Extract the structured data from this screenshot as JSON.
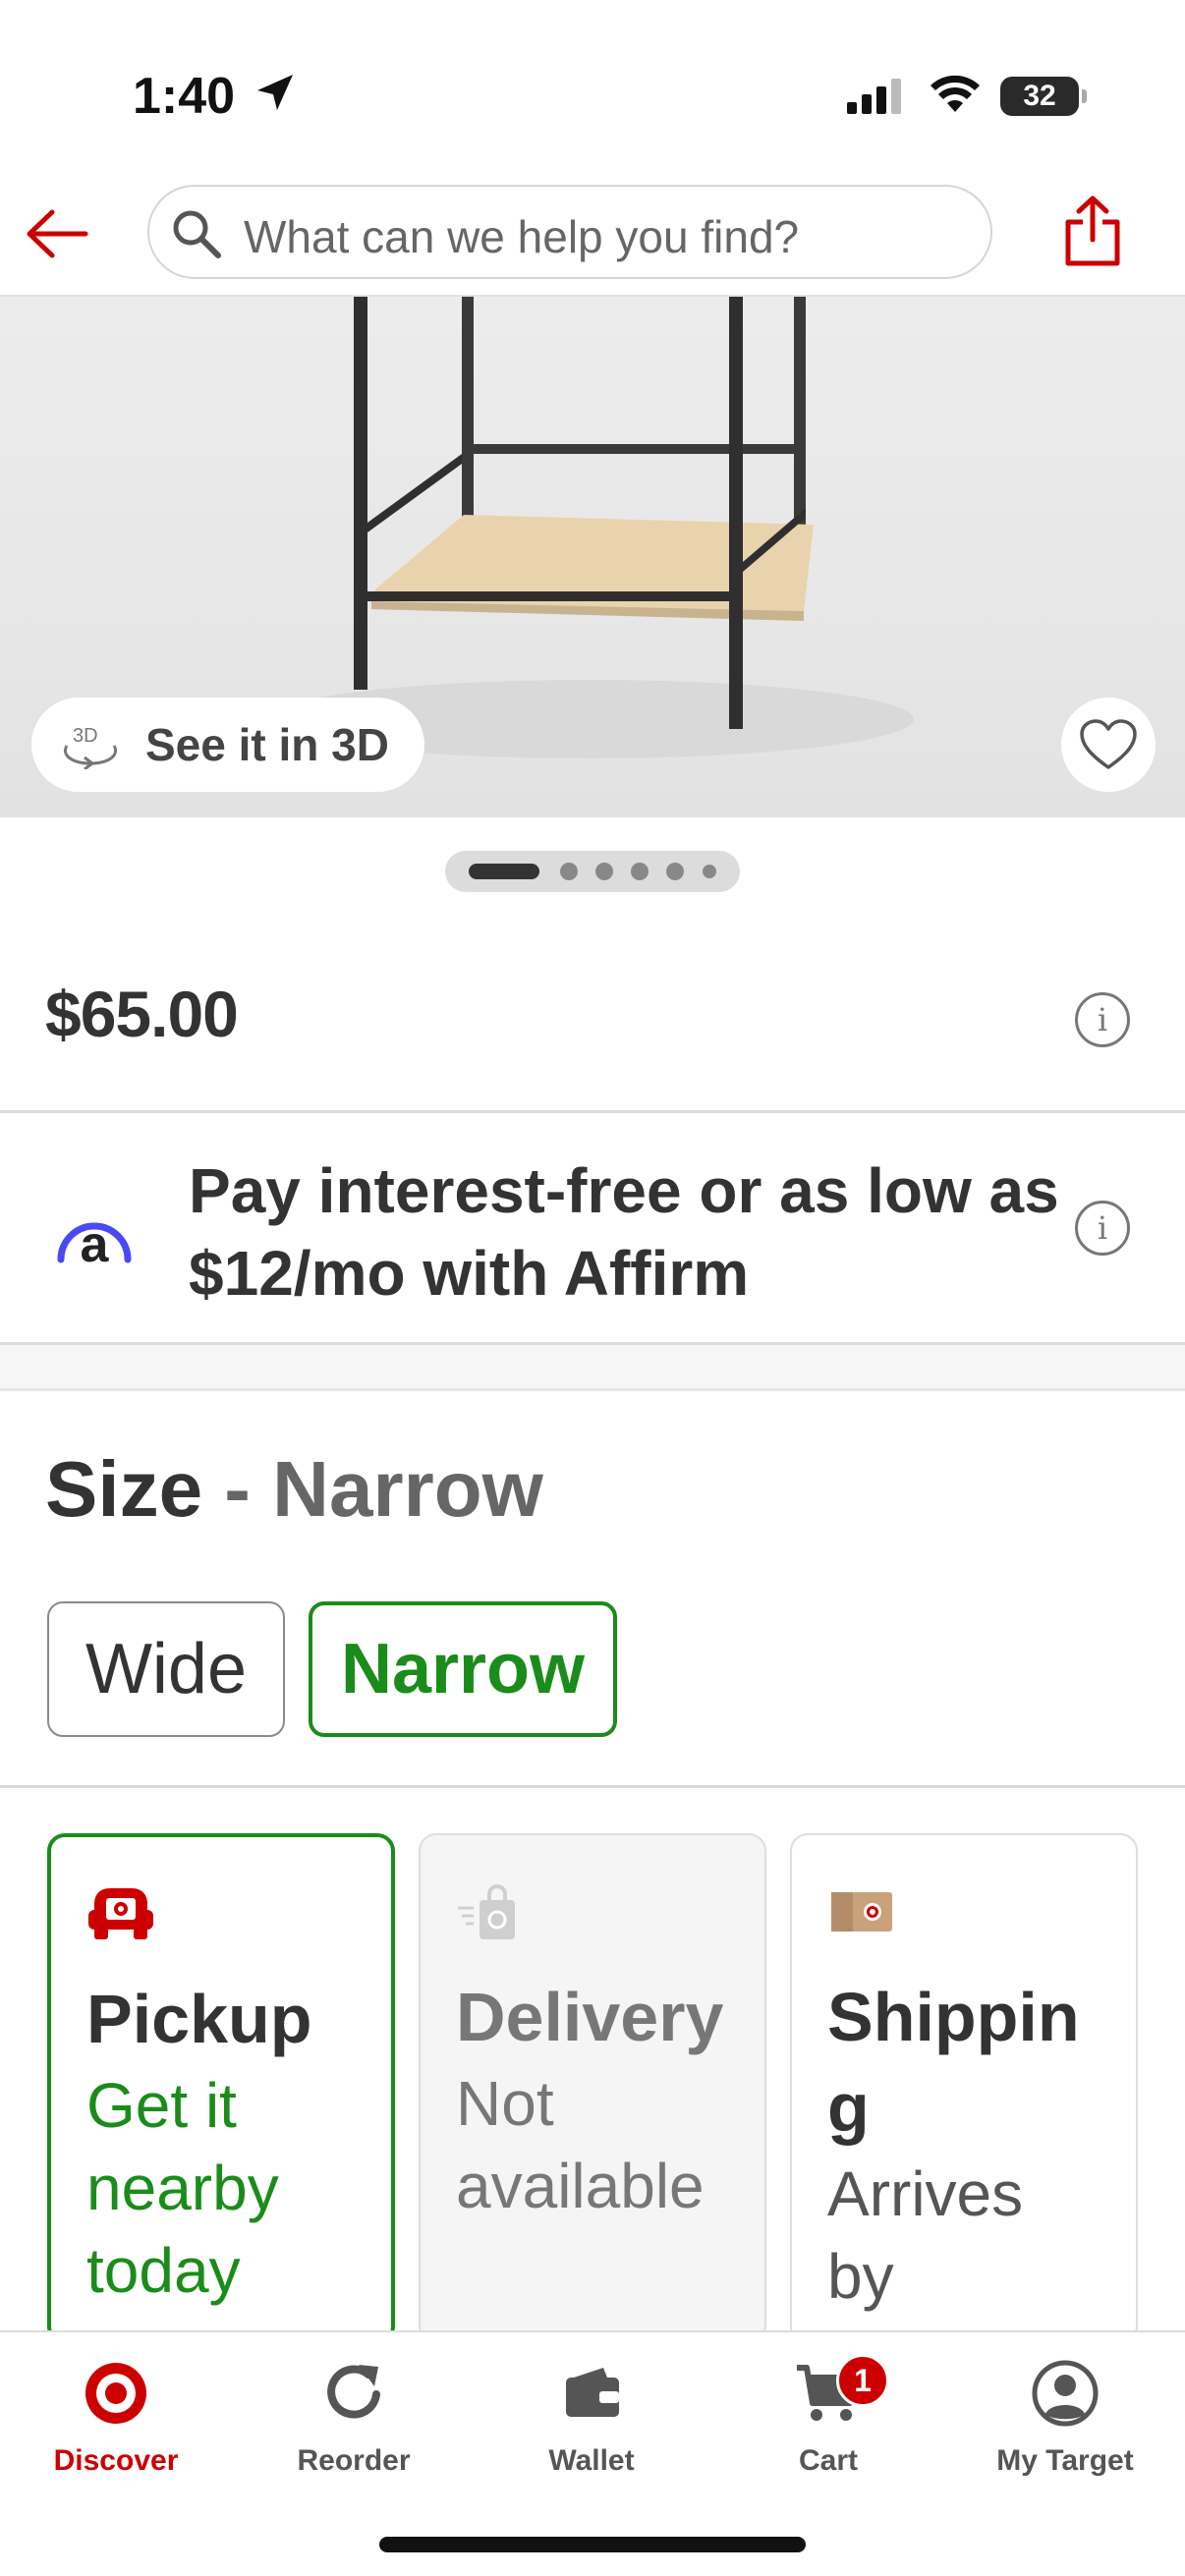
{
  "status_bar": {
    "time": "1:40",
    "battery": "32"
  },
  "header": {
    "search_placeholder": "What can we help you find?"
  },
  "hero": {
    "see_3d_label": "See it in 3D",
    "badge_3d": "3D"
  },
  "carousel": {
    "total": 6,
    "active": 1
  },
  "price": {
    "amount": "$65.00"
  },
  "affirm": {
    "logo_letter": "a",
    "text": "Pay interest-free or as low as $12/mo with Affirm"
  },
  "size": {
    "label": "Size",
    "separator": " - ",
    "selected": "Narrow",
    "options": [
      {
        "label": "Wide",
        "selected": false
      },
      {
        "label": "Narrow",
        "selected": true
      }
    ]
  },
  "fulfillment": [
    {
      "title": "Pickup",
      "subtitle": "Get it nearby today",
      "state": "selected",
      "icon": "pickup-car-icon"
    },
    {
      "title": "Delivery",
      "subtitle": "Not available",
      "state": "disabled",
      "icon": "delivery-bag-icon"
    },
    {
      "title": "Shipping",
      "subtitle": "Arrives by",
      "state": "default",
      "icon": "shipping-box-icon"
    }
  ],
  "bottom_nav": {
    "items": [
      {
        "label": "Discover",
        "icon": "target-bullseye-icon",
        "active": true
      },
      {
        "label": "Reorder",
        "icon": "reorder-icon",
        "active": false
      },
      {
        "label": "Wallet",
        "icon": "wallet-icon",
        "active": false
      },
      {
        "label": "Cart",
        "icon": "cart-icon",
        "active": false,
        "badge": "1"
      },
      {
        "label": "My Target",
        "icon": "account-icon",
        "active": false
      }
    ]
  },
  "colors": {
    "brand_red": "#cc0000",
    "selected_green": "#1a8c1a",
    "affirm_blue": "#4a4af4"
  }
}
